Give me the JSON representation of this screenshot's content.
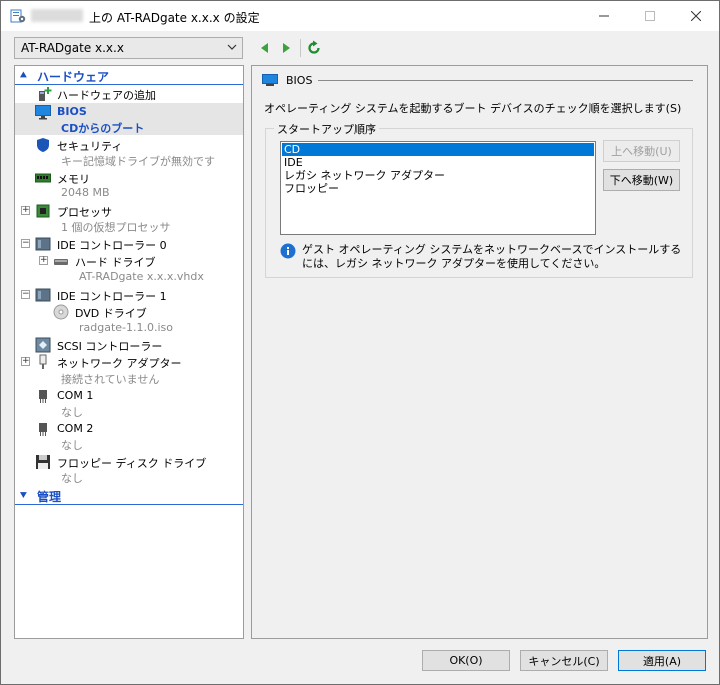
{
  "window": {
    "title": "上の AT-RADgate x.x.x の設定",
    "controls": {
      "minimize_icon": "minimize-icon",
      "maximize_icon": "maximize-icon",
      "close_icon": "close-icon"
    }
  },
  "vm_selector": {
    "value": "AT-RADgate x.x.x"
  },
  "sidebar": {
    "hardware_section": "ハードウェア",
    "management_section": "管理",
    "items": [
      {
        "label": "ハードウェアの追加",
        "sub": ""
      },
      {
        "label": "BIOS",
        "sub": "CDからのブート"
      },
      {
        "label": "セキュリティ",
        "sub": "キー記憶域ドライブが無効です"
      },
      {
        "label": "メモリ",
        "sub": "2048 MB"
      },
      {
        "label": "プロセッサ",
        "sub": "1 個の仮想プロセッサ"
      },
      {
        "label": "IDE コントローラー 0",
        "sub": ""
      },
      {
        "label": "ハード ドライブ",
        "sub": "AT-RADgate x.x.x.vhdx"
      },
      {
        "label": "IDE コントローラー 1",
        "sub": ""
      },
      {
        "label": "DVD ドライブ",
        "sub": "radgate-1.1.0.iso"
      },
      {
        "label": "SCSI コントローラー",
        "sub": ""
      },
      {
        "label": "ネットワーク アダプター",
        "sub": "接続されていません"
      },
      {
        "label": "COM 1",
        "sub": "なし"
      },
      {
        "label": "COM 2",
        "sub": "なし"
      },
      {
        "label": "フロッピー ディスク ドライブ",
        "sub": "なし"
      }
    ]
  },
  "bios": {
    "header": "BIOS",
    "description": "オペレーティング システムを起動するブート デバイスのチェック順を選択します(S)",
    "startup_order_label": "スタートアップ順序",
    "boot_order": [
      "CD",
      "IDE",
      "レガシ ネットワーク アダプター",
      "フロッピー"
    ],
    "selected_index": 0,
    "move_up_label": "上へ移動(U)",
    "move_down_label": "下へ移動(W)",
    "info_text": "ゲスト オペレーティング システムをネットワークベースでインストールするには、レガシ ネットワーク アダプターを使用してください。"
  },
  "footer": {
    "ok_label": "OK(O)",
    "cancel_label": "キャンセル(C)",
    "apply_label": "適用(A)"
  }
}
